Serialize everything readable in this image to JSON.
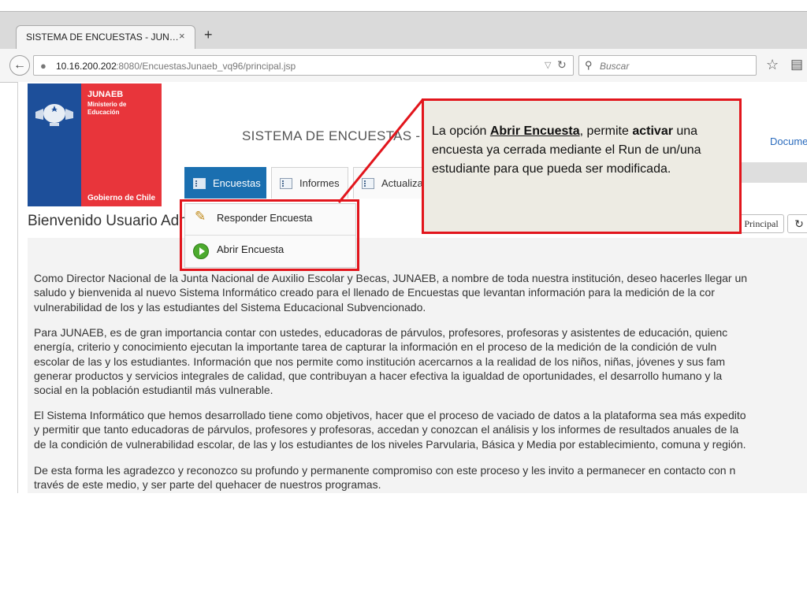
{
  "browser": {
    "tab_title": "SISTEMA DE ENCUESTAS - JUN…",
    "tab_close": "×",
    "new_tab": "+",
    "url_host": "10.16.200.202",
    "url_rest": ":8080/EncuestasJunaeb_vq96/principal.jsp",
    "search_placeholder": "Buscar"
  },
  "logo": {
    "brand": "JUNAEB",
    "ministry_line1": "Ministerio de",
    "ministry_line2": "Educación",
    "footer": "Gobierno de Chile"
  },
  "header": {
    "title": "SISTEMA DE ENCUESTAS - J",
    "doc_link": "Docume"
  },
  "nav": {
    "tabs": [
      {
        "label": "Encuestas",
        "active": true
      },
      {
        "label": "Informes"
      },
      {
        "label": "Actualiza"
      }
    ]
  },
  "dropdown": {
    "items": [
      {
        "label": "Responder Encuesta",
        "icon": "pencil-icon"
      },
      {
        "label": "Abrir Encuesta",
        "icon": "play-icon"
      }
    ]
  },
  "main": {
    "welcome": "Bienvenido Usuario Adm",
    "principal_button": "Principal",
    "paragraphs": [
      [
        "Como Director Nacional de la Junta Nacional de Auxilio Escolar y Becas, JUNAEB, a nombre de toda nuestra institución, deseo hacerles llegar un",
        "saludo y bienvenida al nuevo Sistema Informático creado para el llenado de Encuestas que levantan información para la medición de la cor",
        "vulnerabilidad de los y las estudiantes del Sistema Educacional Subvencionado."
      ],
      [
        "Para JUNAEB, es de gran importancia contar con ustedes, educadoras de párvulos, profesores, profesoras y asistentes de educación, quienc",
        "energía, criterio y conocimiento ejecutan la importante tarea de capturar la información en el proceso de la medición de la condición de vuln",
        "escolar de las y los estudiantes. Información que nos permite como institución acercarnos a la realidad de los niños, niñas, jóvenes y sus fam",
        "generar productos y servicios integrales de calidad, que contribuyan a hacer efectiva la igualdad de oportunidades, el desarrollo humano y la",
        "social en la población estudiantil más vulnerable."
      ],
      [
        "El Sistema Informático que hemos desarrollado tiene como objetivos, hacer que el proceso de vaciado de datos a la plataforma sea más expedito",
        "y permitir que tanto educadoras de párvulos, profesores y profesoras, accedan y conozcan el análisis y los informes de resultados anuales de la",
        "de la condición de vulnerabilidad escolar, de las y los estudiantes de los niveles Parvularia, Básica y Media por establecimiento, comuna y región."
      ],
      [
        "De esta forma les agradezco y reconozco su profundo y permanente compromiso con este proceso y les invito a permanecer en contacto con n",
        "través de este medio, y ser parte del quehacer de nuestros programas."
      ]
    ]
  },
  "callout": {
    "part1": "La opción ",
    "part2": "Abrir Encuesta",
    "part3": ", permite ",
    "part4": "activar",
    "part5": " una encuesta  ya cerrada mediante el Run de un/una estudiante  para que pueda ser modificada."
  },
  "colors": {
    "accent_blue": "#1a6fb0",
    "highlight_red": "#e2151c",
    "logo_blue": "#1d4f9a",
    "logo_red": "#e8353b"
  }
}
